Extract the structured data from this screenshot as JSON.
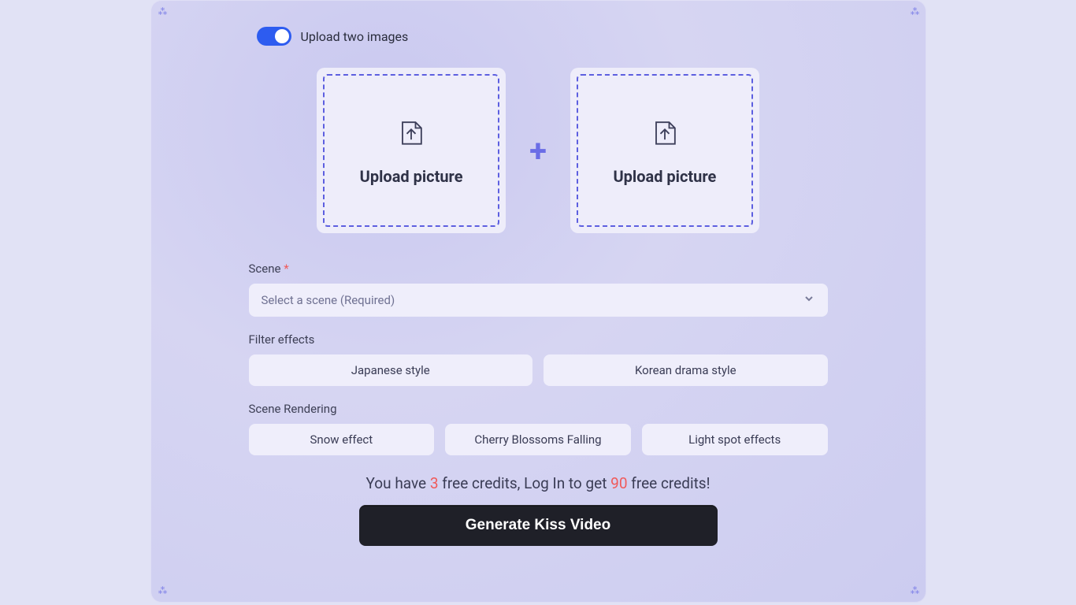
{
  "toggle": {
    "label": "Upload two images",
    "on": true
  },
  "upload": {
    "label": "Upload picture"
  },
  "scene": {
    "label": "Scene",
    "required_marker": "*",
    "placeholder": "Select a scene (Required)"
  },
  "filter": {
    "label": "Filter effects",
    "options": [
      "Japanese style",
      "Korean drama style"
    ]
  },
  "render": {
    "label": "Scene Rendering",
    "options": [
      "Snow effect",
      "Cherry Blossoms Falling",
      "Light spot effects"
    ]
  },
  "credits": {
    "prefix": "You have ",
    "free_count": "3",
    "mid": " free credits, Log In to get ",
    "login_count": "90",
    "suffix": " free credits!"
  },
  "generate_label": "Generate Kiss Video"
}
